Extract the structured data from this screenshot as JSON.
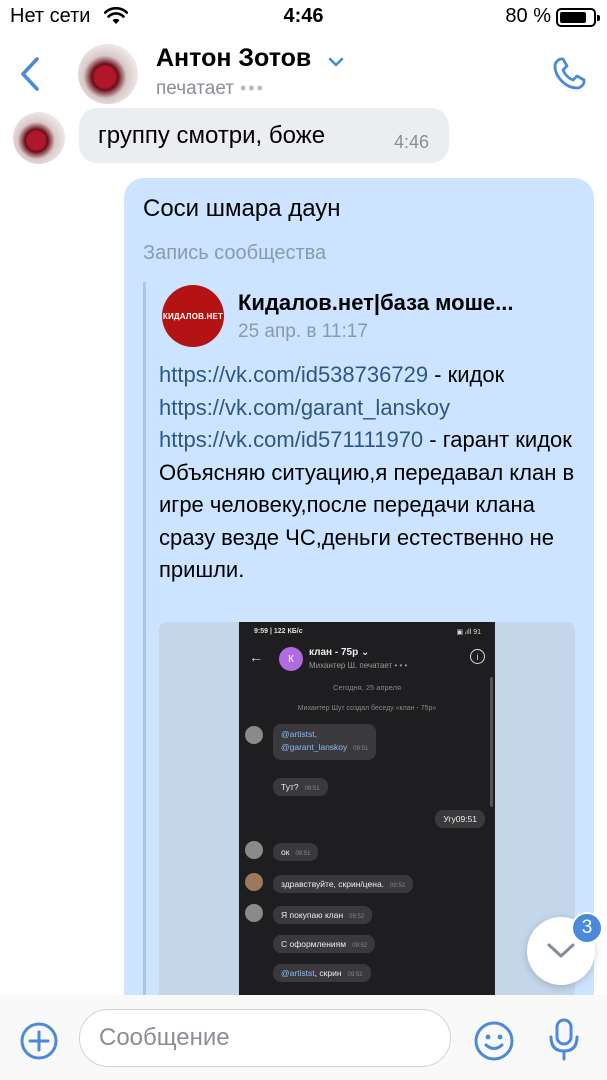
{
  "status_bar": {
    "carrier": "Нет сети",
    "time": "4:46",
    "battery_percent": "80 %",
    "battery_level": 0.8
  },
  "header": {
    "contact_name": "Антон Зотов",
    "status": "печатает",
    "typing_dots": "•••"
  },
  "messages": {
    "incoming": {
      "text": "группу смотри, боже",
      "time": "4:46"
    },
    "outgoing": {
      "text": "Соси шмара даун",
      "repost": {
        "label": "Запись сообщества",
        "avatar_text": "КИДАЛОВ.НЕТ",
        "community_name": "Кидалов.нет|база моше...",
        "date": "25 апр. в 11:17",
        "link1": "https://vk.com/id538736729",
        "suffix1": " - кидок",
        "link2": "https://vk.com/garant_lanskoy",
        "link3": "https://vk.com/id571111970",
        "suffix3": " - гарант кидок",
        "body": "Объясняю ситуацию,я передавал клан в игре человеку,после передачи клана сразу везде ЧС,деньги естественно не пришли.",
        "screenshot": {
          "status_left": "9:59 | 122 КБ/с",
          "status_right": "▣ ᵢıll 91",
          "back": "←",
          "avatar_letter": "К",
          "chat_title": "клан - 75р ⌄",
          "chat_sub": "Михантер Ш. печатает • • •",
          "date": "Сегодня, 25 апреля",
          "created": "Михантер Шут создал беседу «клан - 75р»",
          "info": "i",
          "msgs": {
            "m1a": "@artistst,",
            "m1b": "@garant_lanskoy",
            "m1t": "09:51",
            "m2": "Тут?",
            "m2t": "09:51",
            "m3": "Угу",
            "m3t": "09:51",
            "m4": "ок",
            "m4t": "09:51",
            "m5": "здравствуйте, скрин/цена.",
            "m5t": "09:52",
            "m6": "Я покупаю клан",
            "m6t": "09:52",
            "m7": "С оформлениям",
            "m7t": "09:52",
            "m8a": "@artistst",
            "m8b": ", скрин",
            "m8t": "09:52"
          }
        }
      }
    }
  },
  "scroll_down": {
    "unread_count": "3"
  },
  "composer": {
    "placeholder": "Сообщение"
  },
  "colors": {
    "accent": "#2a5885",
    "icon_blue": "#4a8ad8",
    "outgoing_bubble": "#cce4ff",
    "incoming_bubble": "#ebedf0"
  }
}
